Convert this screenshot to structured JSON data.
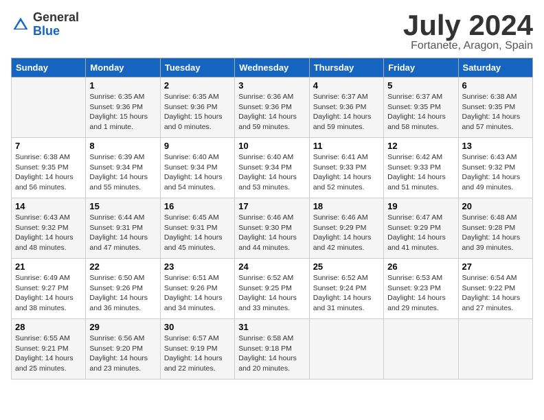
{
  "logo": {
    "general": "General",
    "blue": "Blue"
  },
  "title": "July 2024",
  "subtitle": "Fortanete, Aragon, Spain",
  "days_of_week": [
    "Sunday",
    "Monday",
    "Tuesday",
    "Wednesday",
    "Thursday",
    "Friday",
    "Saturday"
  ],
  "weeks": [
    [
      {
        "day": "",
        "sunrise": "",
        "sunset": "",
        "daylight": ""
      },
      {
        "day": "1",
        "sunrise": "Sunrise: 6:35 AM",
        "sunset": "Sunset: 9:36 PM",
        "daylight": "Daylight: 15 hours and 1 minute."
      },
      {
        "day": "2",
        "sunrise": "Sunrise: 6:35 AM",
        "sunset": "Sunset: 9:36 PM",
        "daylight": "Daylight: 15 hours and 0 minutes."
      },
      {
        "day": "3",
        "sunrise": "Sunrise: 6:36 AM",
        "sunset": "Sunset: 9:36 PM",
        "daylight": "Daylight: 14 hours and 59 minutes."
      },
      {
        "day": "4",
        "sunrise": "Sunrise: 6:37 AM",
        "sunset": "Sunset: 9:36 PM",
        "daylight": "Daylight: 14 hours and 59 minutes."
      },
      {
        "day": "5",
        "sunrise": "Sunrise: 6:37 AM",
        "sunset": "Sunset: 9:35 PM",
        "daylight": "Daylight: 14 hours and 58 minutes."
      },
      {
        "day": "6",
        "sunrise": "Sunrise: 6:38 AM",
        "sunset": "Sunset: 9:35 PM",
        "daylight": "Daylight: 14 hours and 57 minutes."
      }
    ],
    [
      {
        "day": "7",
        "sunrise": "Sunrise: 6:38 AM",
        "sunset": "Sunset: 9:35 PM",
        "daylight": "Daylight: 14 hours and 56 minutes."
      },
      {
        "day": "8",
        "sunrise": "Sunrise: 6:39 AM",
        "sunset": "Sunset: 9:34 PM",
        "daylight": "Daylight: 14 hours and 55 minutes."
      },
      {
        "day": "9",
        "sunrise": "Sunrise: 6:40 AM",
        "sunset": "Sunset: 9:34 PM",
        "daylight": "Daylight: 14 hours and 54 minutes."
      },
      {
        "day": "10",
        "sunrise": "Sunrise: 6:40 AM",
        "sunset": "Sunset: 9:34 PM",
        "daylight": "Daylight: 14 hours and 53 minutes."
      },
      {
        "day": "11",
        "sunrise": "Sunrise: 6:41 AM",
        "sunset": "Sunset: 9:33 PM",
        "daylight": "Daylight: 14 hours and 52 minutes."
      },
      {
        "day": "12",
        "sunrise": "Sunrise: 6:42 AM",
        "sunset": "Sunset: 9:33 PM",
        "daylight": "Daylight: 14 hours and 51 minutes."
      },
      {
        "day": "13",
        "sunrise": "Sunrise: 6:43 AM",
        "sunset": "Sunset: 9:32 PM",
        "daylight": "Daylight: 14 hours and 49 minutes."
      }
    ],
    [
      {
        "day": "14",
        "sunrise": "Sunrise: 6:43 AM",
        "sunset": "Sunset: 9:32 PM",
        "daylight": "Daylight: 14 hours and 48 minutes."
      },
      {
        "day": "15",
        "sunrise": "Sunrise: 6:44 AM",
        "sunset": "Sunset: 9:31 PM",
        "daylight": "Daylight: 14 hours and 47 minutes."
      },
      {
        "day": "16",
        "sunrise": "Sunrise: 6:45 AM",
        "sunset": "Sunset: 9:31 PM",
        "daylight": "Daylight: 14 hours and 45 minutes."
      },
      {
        "day": "17",
        "sunrise": "Sunrise: 6:46 AM",
        "sunset": "Sunset: 9:30 PM",
        "daylight": "Daylight: 14 hours and 44 minutes."
      },
      {
        "day": "18",
        "sunrise": "Sunrise: 6:46 AM",
        "sunset": "Sunset: 9:29 PM",
        "daylight": "Daylight: 14 hours and 42 minutes."
      },
      {
        "day": "19",
        "sunrise": "Sunrise: 6:47 AM",
        "sunset": "Sunset: 9:29 PM",
        "daylight": "Daylight: 14 hours and 41 minutes."
      },
      {
        "day": "20",
        "sunrise": "Sunrise: 6:48 AM",
        "sunset": "Sunset: 9:28 PM",
        "daylight": "Daylight: 14 hours and 39 minutes."
      }
    ],
    [
      {
        "day": "21",
        "sunrise": "Sunrise: 6:49 AM",
        "sunset": "Sunset: 9:27 PM",
        "daylight": "Daylight: 14 hours and 38 minutes."
      },
      {
        "day": "22",
        "sunrise": "Sunrise: 6:50 AM",
        "sunset": "Sunset: 9:26 PM",
        "daylight": "Daylight: 14 hours and 36 minutes."
      },
      {
        "day": "23",
        "sunrise": "Sunrise: 6:51 AM",
        "sunset": "Sunset: 9:26 PM",
        "daylight": "Daylight: 14 hours and 34 minutes."
      },
      {
        "day": "24",
        "sunrise": "Sunrise: 6:52 AM",
        "sunset": "Sunset: 9:25 PM",
        "daylight": "Daylight: 14 hours and 33 minutes."
      },
      {
        "day": "25",
        "sunrise": "Sunrise: 6:52 AM",
        "sunset": "Sunset: 9:24 PM",
        "daylight": "Daylight: 14 hours and 31 minutes."
      },
      {
        "day": "26",
        "sunrise": "Sunrise: 6:53 AM",
        "sunset": "Sunset: 9:23 PM",
        "daylight": "Daylight: 14 hours and 29 minutes."
      },
      {
        "day": "27",
        "sunrise": "Sunrise: 6:54 AM",
        "sunset": "Sunset: 9:22 PM",
        "daylight": "Daylight: 14 hours and 27 minutes."
      }
    ],
    [
      {
        "day": "28",
        "sunrise": "Sunrise: 6:55 AM",
        "sunset": "Sunset: 9:21 PM",
        "daylight": "Daylight: 14 hours and 25 minutes."
      },
      {
        "day": "29",
        "sunrise": "Sunrise: 6:56 AM",
        "sunset": "Sunset: 9:20 PM",
        "daylight": "Daylight: 14 hours and 23 minutes."
      },
      {
        "day": "30",
        "sunrise": "Sunrise: 6:57 AM",
        "sunset": "Sunset: 9:19 PM",
        "daylight": "Daylight: 14 hours and 22 minutes."
      },
      {
        "day": "31",
        "sunrise": "Sunrise: 6:58 AM",
        "sunset": "Sunset: 9:18 PM",
        "daylight": "Daylight: 14 hours and 20 minutes."
      },
      {
        "day": "",
        "sunrise": "",
        "sunset": "",
        "daylight": ""
      },
      {
        "day": "",
        "sunrise": "",
        "sunset": "",
        "daylight": ""
      },
      {
        "day": "",
        "sunrise": "",
        "sunset": "",
        "daylight": ""
      }
    ]
  ]
}
